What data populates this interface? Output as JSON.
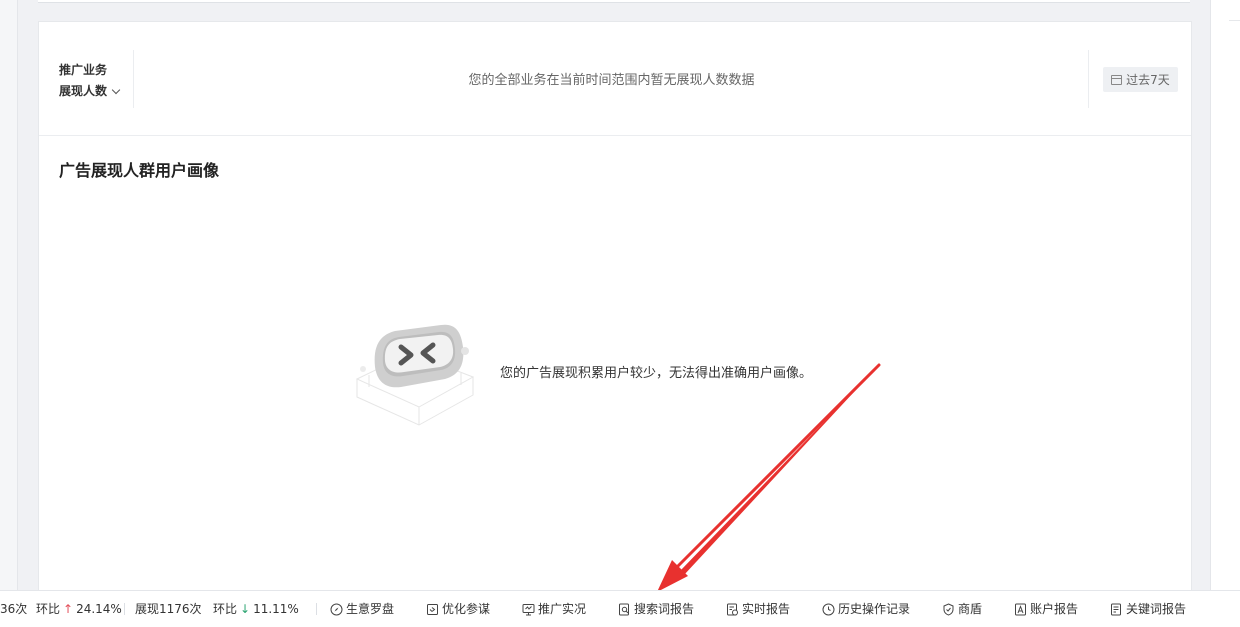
{
  "filter": {
    "label_line1": "推广业务",
    "label_line2": "展现人数",
    "empty_note": "您的全部业务在当前时间范围内暂无展现人数数据",
    "date_range": "过去7天"
  },
  "section": {
    "title": "广告展现人群用户画像",
    "empty_message": "您的广告展现积累用户较少，无法得出准确用户画像。"
  },
  "stats": {
    "clicks_partial": "36次",
    "ring1_label": "环比",
    "ring1_value": "24.14%",
    "impressions": "展现1176次",
    "ring2_label": "环比",
    "ring2_value": "11.11%"
  },
  "toolbar": [
    {
      "label": "生意罗盘",
      "icon": "compass-icon"
    },
    {
      "label": "优化参谋",
      "icon": "advisor-icon"
    },
    {
      "label": "推广实况",
      "icon": "monitor-icon"
    },
    {
      "label": "搜索词报告",
      "icon": "search-report-icon"
    },
    {
      "label": "实时报告",
      "icon": "realtime-report-icon"
    },
    {
      "label": "历史操作记录",
      "icon": "clock-icon"
    },
    {
      "label": "商盾",
      "icon": "shield-icon"
    },
    {
      "label": "账户报告",
      "icon": "account-report-icon"
    },
    {
      "label": "关键词报告",
      "icon": "keyword-report-icon"
    }
  ],
  "colors": {
    "arrow": "#e8312f",
    "up": "#e34d59",
    "down": "#2ba471"
  }
}
